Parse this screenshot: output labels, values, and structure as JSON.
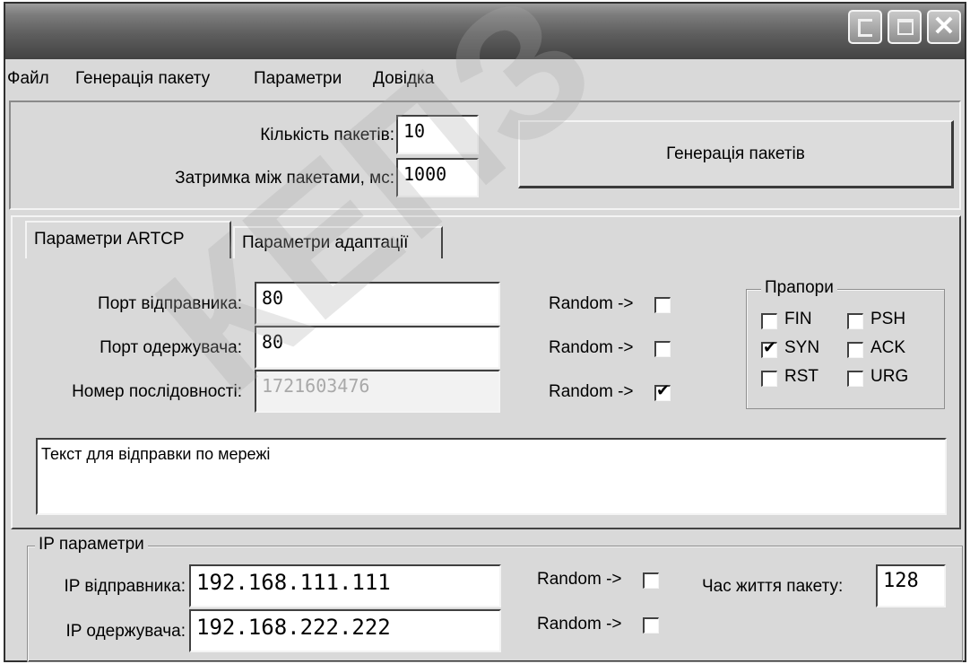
{
  "window": {
    "controls": [
      "minimize-icon",
      "maximize-icon",
      "close-icon"
    ]
  },
  "menu": {
    "items": [
      "Файл",
      "Генерація пакету",
      "Параметри",
      "Довідка"
    ]
  },
  "generation": {
    "packets_label": "Кількість пакетів:",
    "packets_value": "10",
    "delay_label": "Затримка між пакетами, мс:",
    "delay_value": "1000",
    "button_label": "Генерація пакетів"
  },
  "tabs": [
    {
      "label": "Параметри ARTCP",
      "active": true
    },
    {
      "label": "Параметри адаптації",
      "active": false
    }
  ],
  "artcp": {
    "source_port_label": "Порт відправника:",
    "source_port_value": "80",
    "dest_port_label": "Порт одержувача:",
    "dest_port_value": "80",
    "seq_label": "Номер послідовності:",
    "seq_value": "1721603476",
    "random_label": "Random ->",
    "random_checked": [
      false,
      false,
      true
    ],
    "flags_title": "Прапори",
    "flags": [
      {
        "label": "FIN",
        "checked": false
      },
      {
        "label": "PSH",
        "checked": false
      },
      {
        "label": "SYN",
        "checked": true
      },
      {
        "label": "ACK",
        "checked": false
      },
      {
        "label": "RST",
        "checked": false
      },
      {
        "label": "URG",
        "checked": false
      }
    ],
    "payload_text": "Текст для відправки по мережі"
  },
  "ip": {
    "group_title": "IP параметри",
    "source_label": "IP відправника:",
    "source_value": "192.168.111.111",
    "dest_label": "IP одержувача:",
    "dest_value": "192.168.222.222",
    "random_label": "Random ->",
    "random_checked": [
      false,
      false
    ],
    "ttl_label": "Час життя пакету:",
    "ttl_value": "128"
  },
  "watermark": "КЕПЗ"
}
